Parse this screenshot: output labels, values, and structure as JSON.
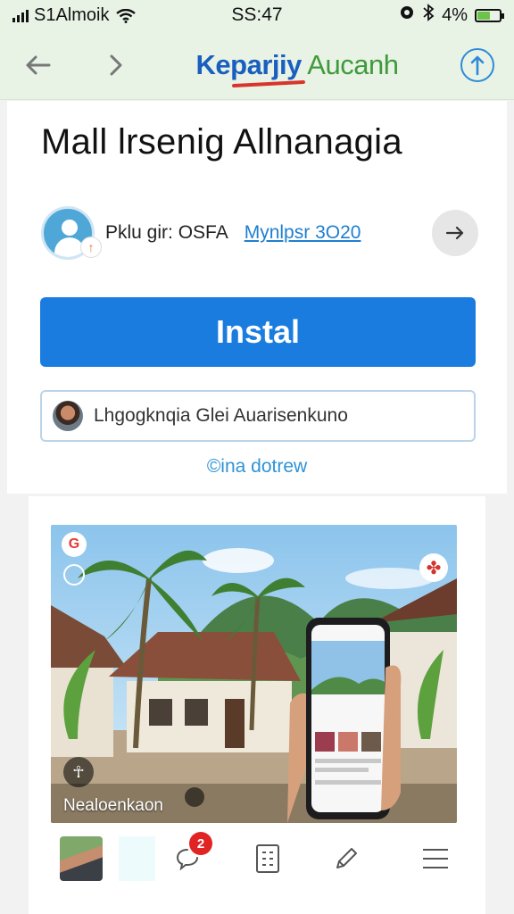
{
  "status_bar": {
    "carrier": "S1Almoik",
    "time": "SS:47",
    "battery_text": "4%",
    "battery_level_fraction": 0.6
  },
  "nav": {
    "brand_part1": "Keparjiy",
    "brand_part2": "Aucanh",
    "back_icon": "arrow-left-icon",
    "forward_icon": "chevron-right-icon",
    "share_icon": "share-up-icon"
  },
  "page": {
    "title": "Mall lrsenig Allnanagia"
  },
  "author": {
    "name": "Pklu gir: OSFA",
    "link": "Mynlpsr 3O20",
    "arrow_icon": "arrow-right-icon"
  },
  "install_button": {
    "label": "Instal",
    "color": "#1b7ce0"
  },
  "search": {
    "placeholder": "Lhgogknqia Glei Auarisenkuno"
  },
  "see_more": {
    "label": "©ina dotrew"
  },
  "preview": {
    "caption": "Nealoenkaon",
    "top_left_badge_icon": "google-badge-icon",
    "top_right_icon": "fan-icon"
  },
  "toolbar": {
    "chat_badge_count": "2",
    "icons": [
      "photo-thumb",
      "chat-bubble-icon",
      "grid-doc-icon",
      "pen-icon",
      "menu-icon"
    ]
  },
  "colors": {
    "header_bg": "#e8f3e6",
    "brand_blue": "#1a5fbf",
    "brand_green": "#3f9a3a",
    "link_blue": "#1f7fd0"
  }
}
